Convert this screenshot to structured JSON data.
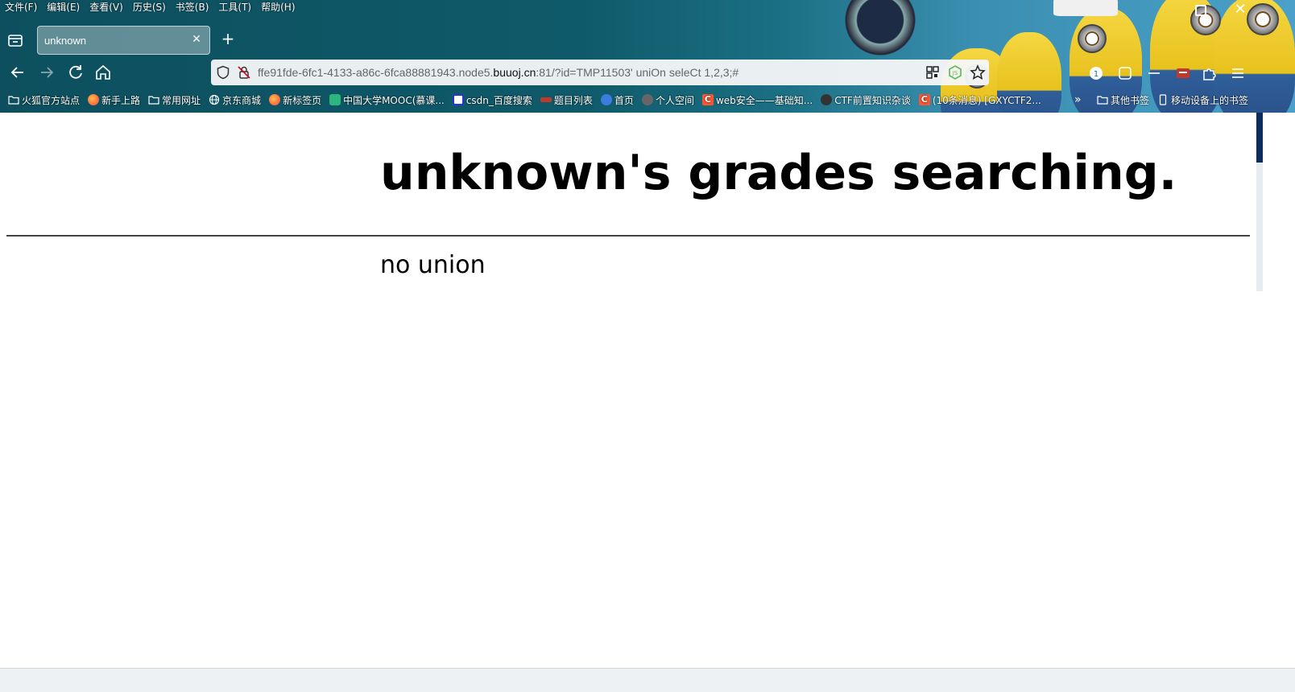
{
  "menubar": {
    "items": [
      "文件(F)",
      "编辑(E)",
      "查看(V)",
      "历史(S)",
      "书签(B)",
      "工具(T)",
      "帮助(H)"
    ]
  },
  "tab": {
    "title": "unknown"
  },
  "urlbar": {
    "url_prefix": "ffe91fde-6fc1-4133-a86c-6fca88881943.node5.",
    "url_host": "buuoj.cn",
    "url_suffix": ":81/?id=TMP11503' uniOn seleCt 1,2,3;#"
  },
  "bookmarks": {
    "items": [
      {
        "label": "火狐官方站点",
        "icon": "folder-icon",
        "color": "#ffffff"
      },
      {
        "label": "新手上路",
        "icon": "firefox-icon",
        "color": "#ff7139"
      },
      {
        "label": "常用网址",
        "icon": "folder-icon",
        "color": "#ffffff"
      },
      {
        "label": "京东商城",
        "icon": "globe-icon",
        "color": "#ffffff"
      },
      {
        "label": "新标签页",
        "icon": "firefox-icon",
        "color": "#ff7139"
      },
      {
        "label": "中国大学MOOC(慕课...",
        "icon": "mooc-icon",
        "color": "#2cb67d"
      },
      {
        "label": "csdn_百度搜索",
        "icon": "baidu-icon",
        "color": "#2932e1"
      },
      {
        "label": "题目列表",
        "icon": "ctf-icon",
        "color": "#c0392b"
      },
      {
        "label": "首页",
        "icon": "home-blue-icon",
        "color": "#3b7ddd"
      },
      {
        "label": "个人空间",
        "icon": "avatar-icon",
        "color": "#666666"
      },
      {
        "label": "web安全——基础知...",
        "icon": "csdn-icon",
        "color": "#fc5531"
      },
      {
        "label": "CTF前置知识杂谈",
        "icon": "play-icon",
        "color": "#333333"
      },
      {
        "label": "(10条消息) [GXYCTF2...",
        "icon": "csdn-icon",
        "color": "#fc5531"
      }
    ],
    "other_bookmarks": "其他书签",
    "mobile_bookmarks": "移动设备上的书签"
  },
  "page": {
    "heading": "unknown's grades searching.",
    "result": "no union"
  }
}
